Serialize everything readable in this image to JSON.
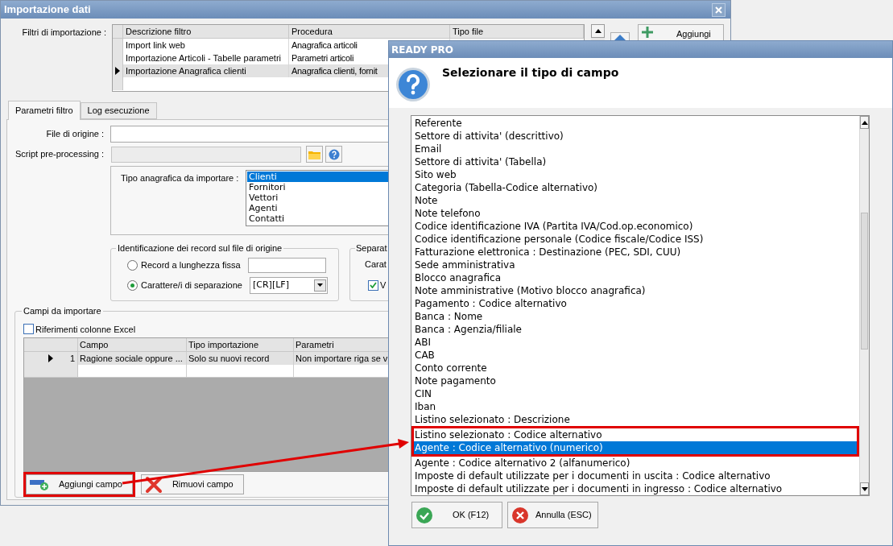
{
  "window": {
    "title": "Importazione dati"
  },
  "filters": {
    "label": "Filtri di importazione :",
    "columns": [
      "Descrizione filtro",
      "Procedura",
      "Tipo file"
    ],
    "rows": [
      {
        "description": "Import link web",
        "procedure": "Anagrafica articoli",
        "selected": false
      },
      {
        "description": "Importazione Articoli - Tabelle parametri",
        "procedure": "Parametri articoli",
        "selected": false
      },
      {
        "description": "Importazione Anagrafica clienti",
        "procedure": "Anagrafica clienti, fornit",
        "selected": true
      }
    ]
  },
  "add_button": {
    "label": "Aggiungi"
  },
  "tabs": [
    {
      "label": "Parametri filtro",
      "selected": true
    },
    {
      "label": "Log esecuzione",
      "selected": false
    }
  ],
  "source_file": {
    "label": "File di origine :"
  },
  "script": {
    "label": "Script pre-processing :"
  },
  "registry_type": {
    "label": "Tipo anagrafica da importare :",
    "options": [
      {
        "label": "Clienti",
        "selected": true
      },
      {
        "label": "Fornitori",
        "selected": false
      },
      {
        "label": "Vettori",
        "selected": false
      },
      {
        "label": "Agenti",
        "selected": false
      },
      {
        "label": "Contatti",
        "selected": false
      }
    ]
  },
  "record_identification": {
    "title": "Identificazione dei record sul file di origine",
    "options": [
      {
        "label": "Record a lunghezza fissa",
        "selected": false,
        "kind": "field"
      },
      {
        "label": "Carattere/i di separazione",
        "selected": true,
        "kind": "combo",
        "value": "[CR][LF]"
      }
    ]
  },
  "separator": {
    "title": "Separat",
    "label": "Carat",
    "checkbox": {
      "label": "V",
      "checked": true
    }
  },
  "fields": {
    "title": "Campi da importare",
    "excel_refs": {
      "label": "Riferimenti colonne Excel",
      "checked": false
    },
    "columns": [
      "Campo",
      "Tipo importazione",
      "Parametri"
    ],
    "rows": [
      {
        "number": "1",
        "field": "Ragione sociale oppure ...",
        "import_type": "Solo su nuovi record",
        "parameters": "Non importare riga se v",
        "selected": true
      }
    ]
  },
  "buttons": [
    {
      "label": "Aggiungi campo",
      "kind": "add",
      "highlighted": true
    },
    {
      "label": "Rimuovi campo",
      "kind": "remove",
      "highlighted": false
    }
  ],
  "dialog": {
    "title": "READY PRO",
    "prompt": "Selezionare il tipo di campo",
    "items": [
      {
        "label": "Referente",
        "selected": false,
        "highlighted": false
      },
      {
        "label": "Settore di attivita' (descrittivo)",
        "selected": false,
        "highlighted": false
      },
      {
        "label": "Email",
        "selected": false,
        "highlighted": false
      },
      {
        "label": "Settore di attivita' (Tabella)",
        "selected": false,
        "highlighted": false
      },
      {
        "label": "Sito web",
        "selected": false,
        "highlighted": false
      },
      {
        "label": "Categoria (Tabella-Codice alternativo)",
        "selected": false,
        "highlighted": false
      },
      {
        "label": "Note",
        "selected": false,
        "highlighted": false
      },
      {
        "label": "Note telefono",
        "selected": false,
        "highlighted": false
      },
      {
        "label": "Codice identificazione IVA (Partita IVA/Cod.op.economico)",
        "selected": false,
        "highlighted": false
      },
      {
        "label": "Codice identificazione personale (Codice fiscale/Codice ISS)",
        "selected": false,
        "highlighted": false
      },
      {
        "label": "Fatturazione elettronica : Destinazione (PEC, SDI, CUU)",
        "selected": false,
        "highlighted": false
      },
      {
        "label": "Sede amministrativa",
        "selected": false,
        "highlighted": false
      },
      {
        "label": "Blocco anagrafica",
        "selected": false,
        "highlighted": false
      },
      {
        "label": "Note amministrative (Motivo blocco anagrafica)",
        "selected": false,
        "highlighted": false
      },
      {
        "label": "Pagamento : Codice alternativo",
        "selected": false,
        "highlighted": false
      },
      {
        "label": "Banca : Nome",
        "selected": false,
        "highlighted": false
      },
      {
        "label": "Banca : Agenzia/filiale",
        "selected": false,
        "highlighted": false
      },
      {
        "label": "ABI",
        "selected": false,
        "highlighted": false
      },
      {
        "label": "CAB",
        "selected": false,
        "highlighted": false
      },
      {
        "label": "Conto corrente",
        "selected": false,
        "highlighted": false
      },
      {
        "label": "Note pagamento",
        "selected": false,
        "highlighted": false
      },
      {
        "label": "CIN",
        "selected": false,
        "highlighted": false
      },
      {
        "label": "Iban",
        "selected": false,
        "highlighted": false
      },
      {
        "label": "Listino selezionato : Descrizione",
        "selected": false,
        "highlighted": false
      },
      {
        "label": "Listino selezionato : Codice alternativo",
        "selected": false,
        "highlighted": true
      },
      {
        "label": "Agente : Codice alternativo (numerico)",
        "selected": true,
        "highlighted": true
      },
      {
        "label": "Agente : Codice alternativo 2 (alfanumerico)",
        "selected": false,
        "highlighted": false
      },
      {
        "label": "Imposte di default utilizzate per i documenti in uscita : Codice alternativo",
        "selected": false,
        "highlighted": false
      },
      {
        "label": "Imposte di default utilizzate per i documenti in ingresso : Codice alternativo",
        "selected": false,
        "highlighted": false
      }
    ],
    "buttons": [
      {
        "label": "OK (F12)",
        "kind": "ok"
      },
      {
        "label": "Annulla (ESC)",
        "kind": "cancel"
      }
    ]
  }
}
